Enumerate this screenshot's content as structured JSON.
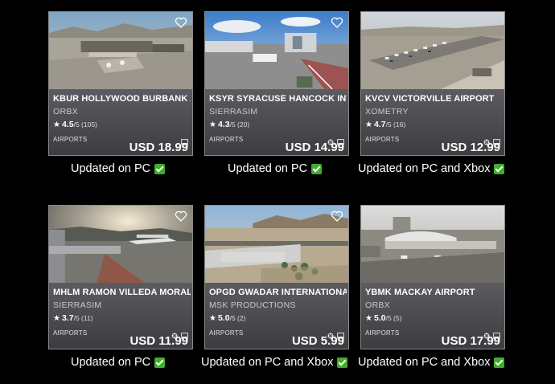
{
  "cards": [
    {
      "title": "KBUR HOLLYWOOD BURBANK AIRP",
      "publisher": "ORBX",
      "rating": "4.5",
      "rating_suffix": "/5 (105)",
      "category": "AIRPORTS",
      "price": "USD 18.99",
      "platforms": [
        "pc-icon"
      ],
      "status": "Updated on PC"
    },
    {
      "title": "KSYR SYRACUSE HANCOCK INTERN",
      "publisher": "SIERRASIM",
      "rating": "4.3",
      "rating_suffix": "/5 (20)",
      "category": "AIRPORTS",
      "price": "USD 14.99",
      "platforms": [
        "xbox-icon",
        "pc-icon"
      ],
      "status": "Updated on PC"
    },
    {
      "title": "KVCV VICTORVILLE AIRPORT",
      "publisher": "XOMETRY",
      "rating": "4.7",
      "rating_suffix": "/5 (16)",
      "category": "AIRPORTS",
      "price": "USD 12.99",
      "platforms": [
        "xbox-icon",
        "pc-icon"
      ],
      "status": "Updated on PC and Xbox"
    },
    {
      "title": "MHLM RAMÓN VILLEDA MORALES I",
      "publisher": "SIERRASIM",
      "rating": "3.7",
      "rating_suffix": "/5 (11)",
      "category": "AIRPORTS",
      "price": "USD 11.99",
      "platforms": [
        "xbox-icon",
        "pc-icon"
      ],
      "status": "Updated on PC"
    },
    {
      "title": "OPGD GWADAR INTERNATIONAL AI",
      "publisher": "MSK PRODUCTIONS",
      "rating": "5.0",
      "rating_suffix": "/5 (2)",
      "category": "AIRPORTS",
      "price": "USD 5.99",
      "platforms": [
        "xbox-icon",
        "pc-icon"
      ],
      "status": "Updated on PC and Xbox"
    },
    {
      "title": "YBMK MACKAY AIRPORT",
      "publisher": "ORBX",
      "rating": "5.0",
      "rating_suffix": "/5 (5)",
      "category": "AIRPORTS",
      "price": "USD 17.99",
      "platforms": [
        "xbox-icon",
        "pc-icon"
      ],
      "status": "Updated on PC and Xbox"
    }
  ],
  "icons": {
    "heart": "heart-outline-icon",
    "star": "star-icon",
    "check": "checkmark-icon"
  },
  "colors": {
    "check_green": "#3fae2a",
    "card_bg": "#4a4a4e"
  }
}
